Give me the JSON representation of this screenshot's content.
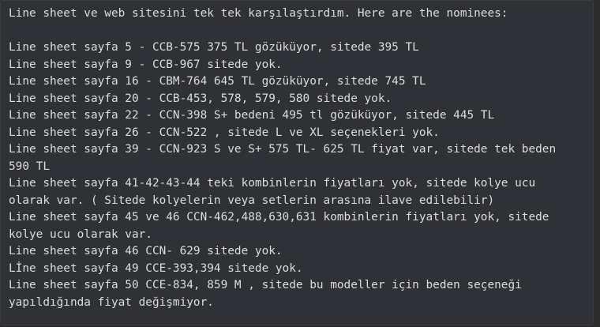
{
  "message": {
    "lines": [
      "Line sheet ve web sitesini tek tek karşılaştırdım. Here are the nominees:",
      "",
      "Line sheet sayfa 5 - CCB-575 375 TL gözüküyor, sitede 395 TL",
      "Line sheet sayfa 9 - CCB-967 sitede yok.",
      "Line sheet sayfa 16 - CBM-764 645 TL gözüküyor, sitede 745 TL",
      "Line sheet sayfa 20 - CCB-453, 578, 579, 580 sitede yok.",
      "Line sheet sayfa 22 - CCN-398 S+ bedeni 495 tl gözüküyor, sitede 445 TL",
      "Line sheet sayfa 26 - CCN-522 , sitede L ve XL seçenekleri yok.",
      "Line sheet sayfa 39 - CCN-923 S ve S+ 575 TL- 625 TL fiyat var, sitede tek beden 590 TL",
      "Line sheet sayfa 41-42-43-44 teki kombinlerin fiyatları yok, sitede kolye ucu olarak var. ( Sitede kolyelerin veya setlerin arasına ilave edilebilir)",
      "Line sheet sayfa 45 ve 46 CCN-462,488,630,631 kombinlerin fiyatları yok, sitede kolye ucu olarak var.",
      "Line sheet sayfa 46 CCN- 629 sitede yok.",
      "Lİne sheet sayfa 49 CCE-393,394 sitede yok.",
      "Line sheet sayfa 50 CCE-834, 859 M , sitede bu modeller için beden seçeneği yapıldığında fiyat değişmiyor."
    ]
  }
}
